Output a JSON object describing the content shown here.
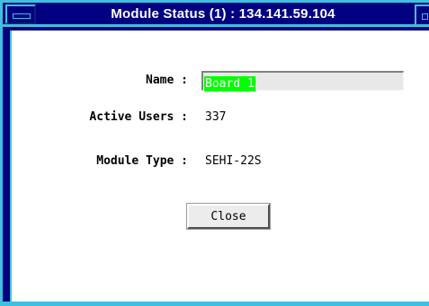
{
  "window": {
    "title": "Module Status (1) : 134.141.59.104"
  },
  "fields": {
    "name_label": "Name :",
    "name_value": "Board 1",
    "active_users_label": "Active Users :",
    "active_users_value": "337",
    "module_type_label": "Module Type :",
    "module_type_value": "SEHI-22S"
  },
  "buttons": {
    "close_label": "Close"
  },
  "colors": {
    "frame": "#000080",
    "frame_highlight": "#40c0e0",
    "selection": "#00ff00"
  }
}
